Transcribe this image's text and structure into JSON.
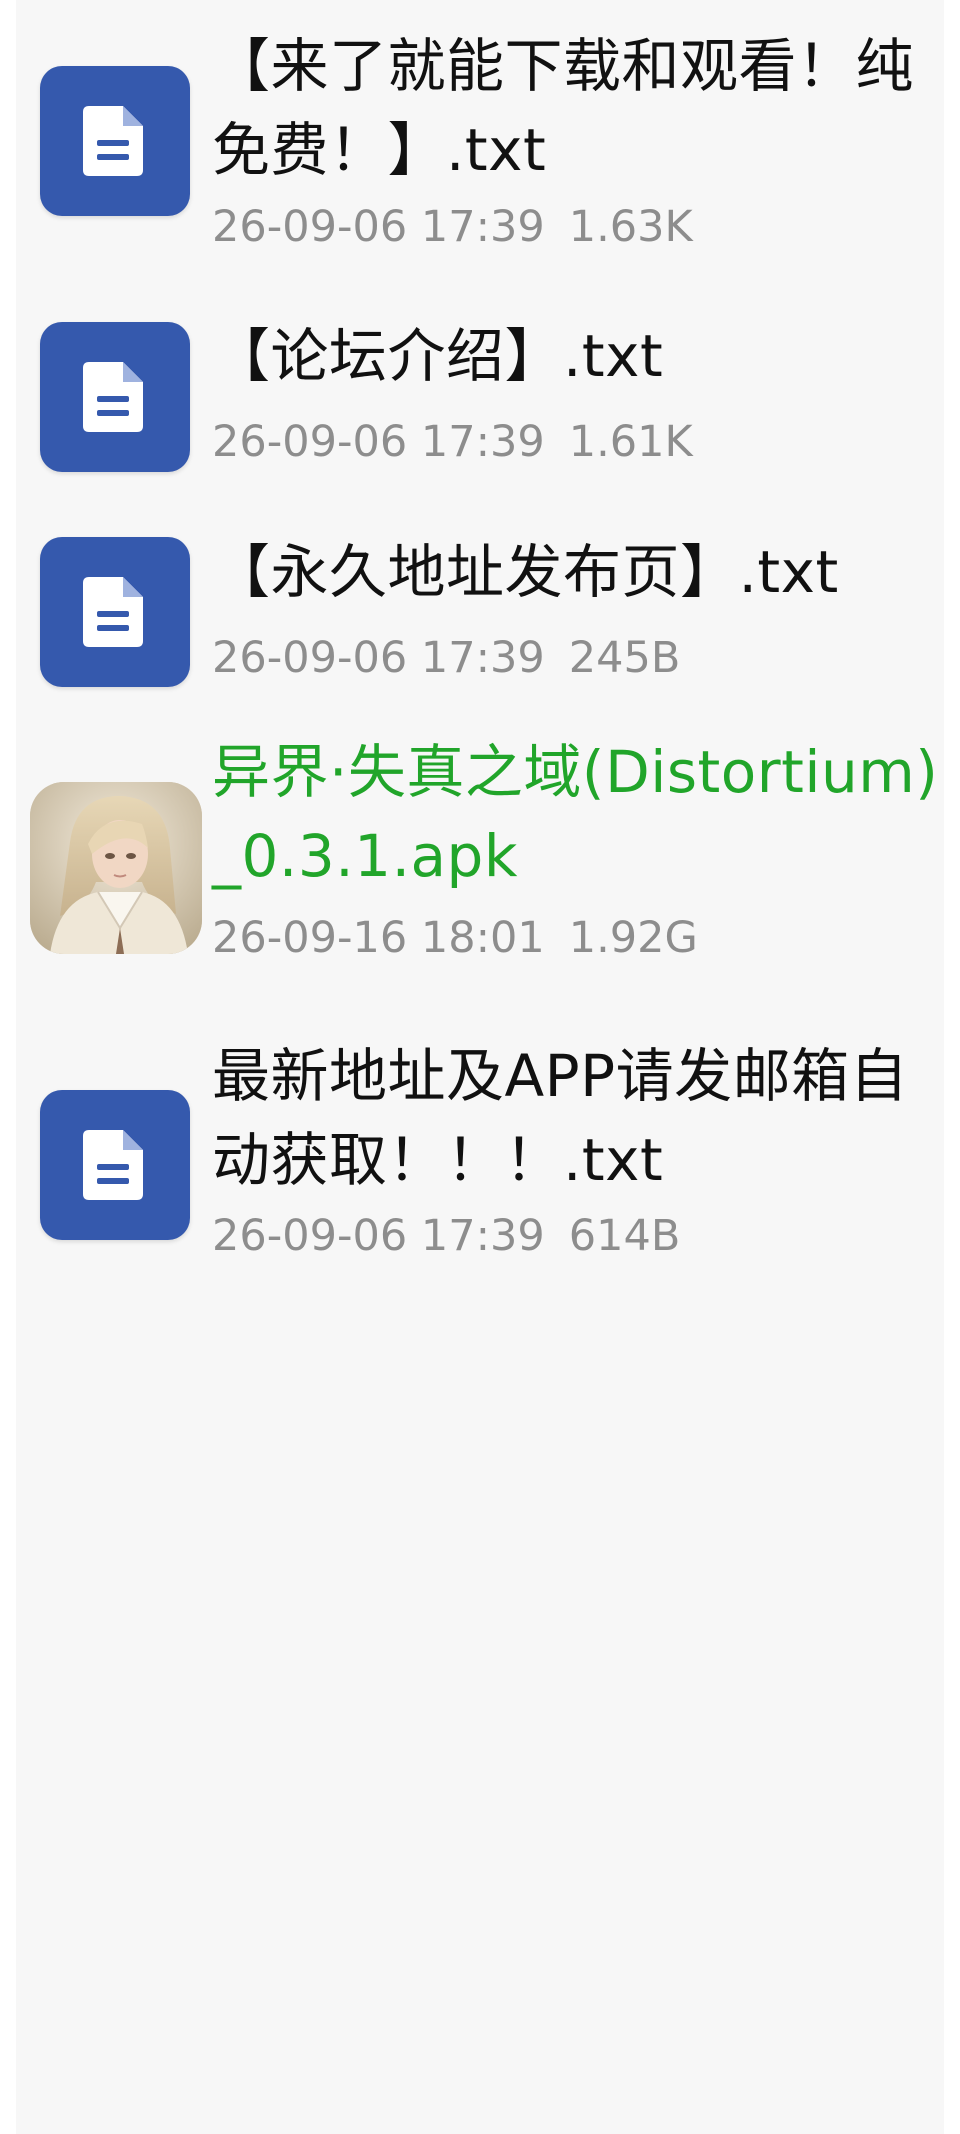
{
  "files": [
    {
      "name": "【来了就能下载和观看！纯免费！】.txt",
      "date": "26-09-06 17:39",
      "size": "1.63K",
      "type": "txt",
      "icon": "document-icon"
    },
    {
      "name": "【论坛介绍】.txt",
      "date": "26-09-06 17:39",
      "size": "1.61K",
      "type": "txt",
      "icon": "document-icon"
    },
    {
      "name": "【永久地址发布页】.txt",
      "date": "26-09-06 17:39",
      "size": "245B",
      "type": "txt",
      "icon": "document-icon"
    },
    {
      "name": "异界·失真之域(Distortium)_0.3.1.apk",
      "date": "26-09-16 18:01",
      "size": "1.92G",
      "type": "apk",
      "icon": "app-thumbnail-icon"
    },
    {
      "name": "最新地址及APP请发邮箱自动获取！！！.txt",
      "date": "26-09-06 17:39",
      "size": "614B",
      "type": "txt",
      "icon": "document-icon"
    }
  ],
  "colors": {
    "document_icon_background": "#3559ad",
    "apk_name_color": "#21a52a",
    "meta_color": "#8d8d8d",
    "panel_background": "#f7f7f7"
  }
}
